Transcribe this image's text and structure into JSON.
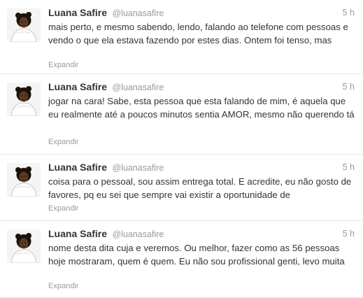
{
  "tweets": [
    {
      "name": "Luana Safire",
      "handle": "@luanasafire",
      "time": "5 h",
      "text": "mais perto, e mesmo sabendo, lendo, falando ao telefone com pessoas e vendo o que ela estava fazendo por estes dias. Ontem foi tenso, mas",
      "expand": "Expandir",
      "avatar_icon": "user-avatar"
    },
    {
      "name": "Luana Safire",
      "handle": "@luanasafire",
      "time": "5 h",
      "text": "jogar na cara! Sabe, esta pessoa que esta falando de mim, é aquela que eu realmente até a poucos minutos sentia AMOR, mesmo não querendo tá",
      "expand": "Expandir",
      "avatar_icon": "user-avatar"
    },
    {
      "name": "Luana Safire",
      "handle": "@luanasafire",
      "time": "5 h",
      "text": "coisa para o pessoal, sou assim entrega total. E acredite, eu não gosto de favores, pq eu sei que sempre vai existir a oportunidade de",
      "expand": "Expandir",
      "avatar_icon": "user-avatar"
    },
    {
      "name": "Luana Safire",
      "handle": "@luanasafire",
      "time": "5 h",
      "text": "nome desta dita cuja e veremos. Ou melhor, fazer como as 56 pessoas hoje mostraram, quem é quem. Eu não sou profissional genti, levo muita",
      "expand": "Expandir",
      "avatar_icon": "user-avatar"
    }
  ]
}
